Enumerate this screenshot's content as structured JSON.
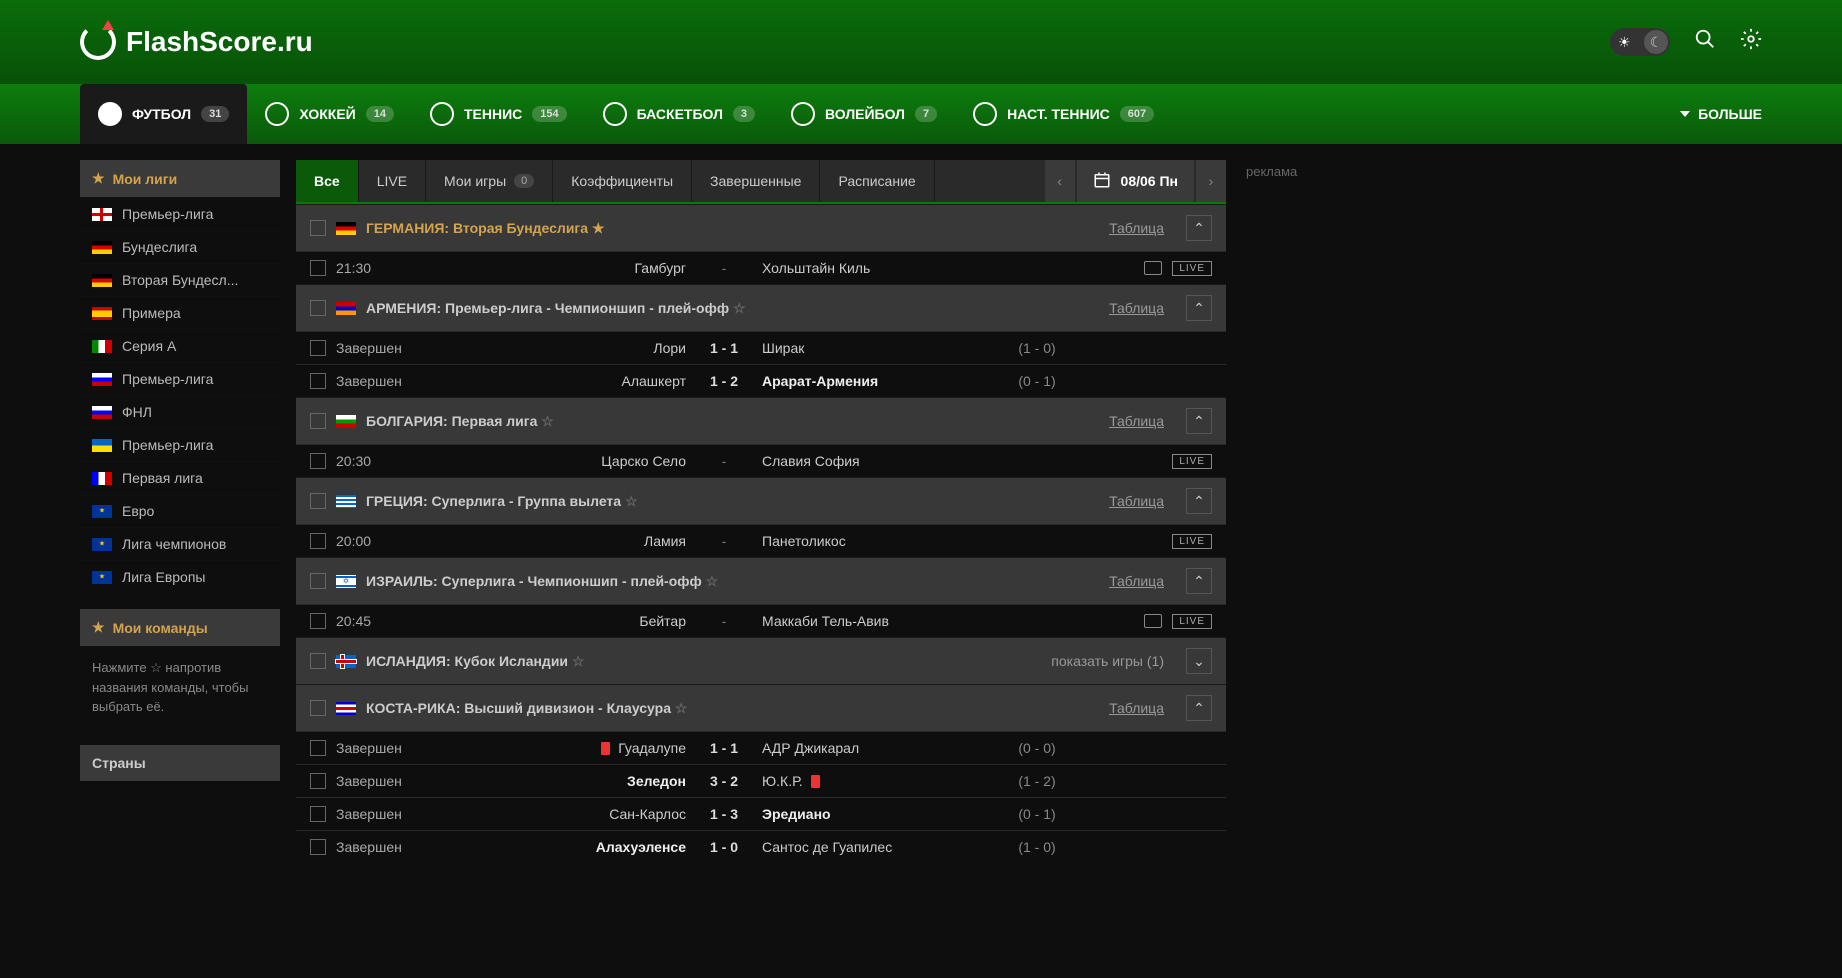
{
  "logo": "FlashScore.ru",
  "sports": [
    {
      "label": "ФУТБОЛ",
      "count": "31",
      "active": true
    },
    {
      "label": "ХОККЕЙ",
      "count": "14"
    },
    {
      "label": "ТЕННИС",
      "count": "154"
    },
    {
      "label": "БАСКЕТБОЛ",
      "count": "3"
    },
    {
      "label": "ВОЛЕЙБОЛ",
      "count": "7"
    },
    {
      "label": "НАСТ. ТЕННИС",
      "count": "607"
    }
  ],
  "more": "БОЛЬШЕ",
  "sidebar": {
    "my_leagues": "Мои лиги",
    "leagues": [
      {
        "label": "Премьер-лига",
        "flag": "fl-eng"
      },
      {
        "label": "Бундеслига",
        "flag": "fl-ger"
      },
      {
        "label": "Вторая Бундесл...",
        "flag": "fl-ger"
      },
      {
        "label": "Примера",
        "flag": "fl-esp"
      },
      {
        "label": "Серия А",
        "flag": "fl-ita"
      },
      {
        "label": "Премьер-лига",
        "flag": "fl-rus"
      },
      {
        "label": "ФНЛ",
        "flag": "fl-rus"
      },
      {
        "label": "Премьер-лига",
        "flag": "fl-ukr"
      },
      {
        "label": "Первая лига",
        "flag": "fl-fra"
      },
      {
        "label": "Евро",
        "flag": "fl-eur"
      },
      {
        "label": "Лига чемпионов",
        "flag": "fl-eur"
      },
      {
        "label": "Лига Европы",
        "flag": "fl-eur"
      }
    ],
    "my_teams": "Мои команды",
    "teams_hint": "Нажмите ☆ напротив названия команды, чтобы выбрать её.",
    "countries": "Страны"
  },
  "filters": {
    "all": "Все",
    "live": "LIVE",
    "my_games": "Мои игры",
    "my_games_count": "0",
    "odds": "Коэффициенты",
    "finished": "Завершенные",
    "scheduled": "Расписание"
  },
  "date": "08/06 Пн",
  "table_link": "Таблица",
  "leagues_data": [
    {
      "name": "ГЕРМАНИЯ: Вторая Бундеслига",
      "flag": "fl-ger",
      "pinned": true,
      "table": true,
      "expand": "up",
      "matches": [
        {
          "status": "21:30",
          "home": "Гамбург",
          "score": "-",
          "away": "Хольштайн Киль",
          "ht": "",
          "tv": true,
          "live": true
        }
      ]
    },
    {
      "name": "АРМЕНИЯ: Премьер-лига - Чемпионшип - плей-офф",
      "flag": "fl-arm",
      "table": true,
      "expand": "up",
      "matches": [
        {
          "status": "Завершен",
          "home": "Лори",
          "score": "1 - 1",
          "away": "Ширак",
          "ht": "(1 - 0)"
        },
        {
          "status": "Завершен",
          "home": "Алашкерт",
          "score": "1 - 2",
          "away": "Арарат-Армения",
          "away_bold": true,
          "ht": "(0 - 1)"
        }
      ]
    },
    {
      "name": "БОЛГАРИЯ: Первая лига",
      "flag": "fl-bul",
      "table": true,
      "expand": "up",
      "matches": [
        {
          "status": "20:30",
          "home": "Царско Село",
          "score": "-",
          "away": "Славия София",
          "ht": "",
          "live": true
        }
      ]
    },
    {
      "name": "ГРЕЦИЯ: Суперлига - Группа вылета",
      "flag": "fl-gre",
      "table": true,
      "expand": "up",
      "matches": [
        {
          "status": "20:00",
          "home": "Ламия",
          "score": "-",
          "away": "Панетоликос",
          "ht": "",
          "live": true
        }
      ]
    },
    {
      "name": "ИЗРАИЛЬ: Суперлига - Чемпионшип - плей-офф",
      "flag": "fl-isr",
      "table": true,
      "expand": "up",
      "matches": [
        {
          "status": "20:45",
          "home": "Бейтар",
          "score": "-",
          "away": "Маккаби Тель-Авив",
          "ht": "",
          "tv": true,
          "live": true
        }
      ]
    },
    {
      "name": "ИСЛАНДИЯ: Кубок Исландии",
      "flag": "fl-ice",
      "show_games": "показать игры (1)",
      "expand": "down"
    },
    {
      "name": "КОСТА-РИКА: Высший дивизион - Клаусура",
      "flag": "fl-cos",
      "table": true,
      "expand": "up",
      "matches": [
        {
          "status": "Завершен",
          "home": "Гуадалупе",
          "home_red": true,
          "score": "1 - 1",
          "away": "АДР Джикарал",
          "ht": "(0 - 0)"
        },
        {
          "status": "Завершен",
          "home": "Зеледон",
          "home_bold": true,
          "score": "3 - 2",
          "away": "Ю.К.Р.",
          "away_red": true,
          "ht": "(1 - 2)"
        },
        {
          "status": "Завершен",
          "home": "Сан-Карлос",
          "score": "1 - 3",
          "away": "Эредиано",
          "away_bold": true,
          "ht": "(0 - 1)"
        },
        {
          "status": "Завершен",
          "home": "Алахуэленсе",
          "home_bold": true,
          "score": "1 - 0",
          "away": "Сантос де Гуапилес",
          "ht": "(1 - 0)"
        }
      ]
    }
  ],
  "ad": "реклама"
}
